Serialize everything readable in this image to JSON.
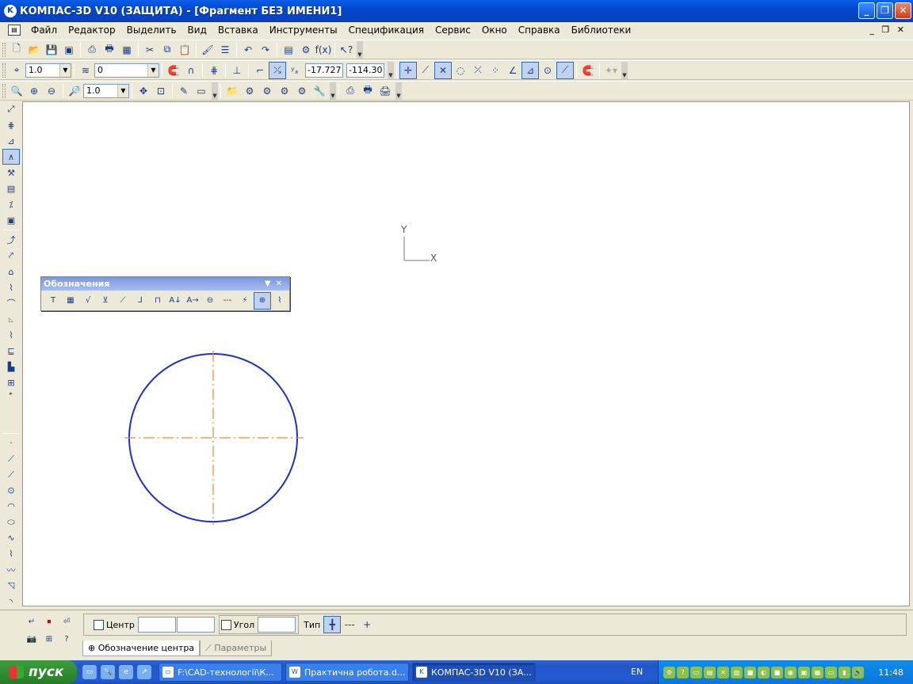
{
  "window": {
    "title": "КОМПАС-3D V10 (ЗАЩИТА) - [Фрагмент БЕЗ ИМЕНИ1]",
    "app_icon": "K"
  },
  "menu": [
    "Файл",
    "Редактор",
    "Выделить",
    "Вид",
    "Вставка",
    "Инструменты",
    "Спецификация",
    "Сервис",
    "Окно",
    "Справка",
    "Библиотеки"
  ],
  "toolbar2": {
    "step": "1.0",
    "layer": "0",
    "coord_x": "-17.727",
    "coord_y": "-114.30"
  },
  "toolbar3": {
    "zoom": "1.0"
  },
  "axes": {
    "x": "X",
    "y": "Y"
  },
  "panel": {
    "title": "Обозначения"
  },
  "props": {
    "center_label": "Центр",
    "angle_label": "Угол",
    "type_label": "Тип"
  },
  "tabs": [
    {
      "label": "Обозначение центра",
      "active": true
    },
    {
      "label": "Параметры",
      "active": false
    }
  ],
  "taskbar": {
    "start": "пуск",
    "tasks": [
      {
        "label": "F:\\CAD-технології\\К...",
        "icon": "folder-icon"
      },
      {
        "label": "Практична робота.d...",
        "icon": "word-document-icon"
      },
      {
        "label": "КОМПАС-3D V10 (ЗА...",
        "icon": "kompas-icon",
        "active": true
      }
    ],
    "lang": "EN",
    "clock": "11:48"
  },
  "colors": {
    "circle": "#1a2fd0",
    "centerline": "#f08a20",
    "canvas": "#ffffff"
  }
}
